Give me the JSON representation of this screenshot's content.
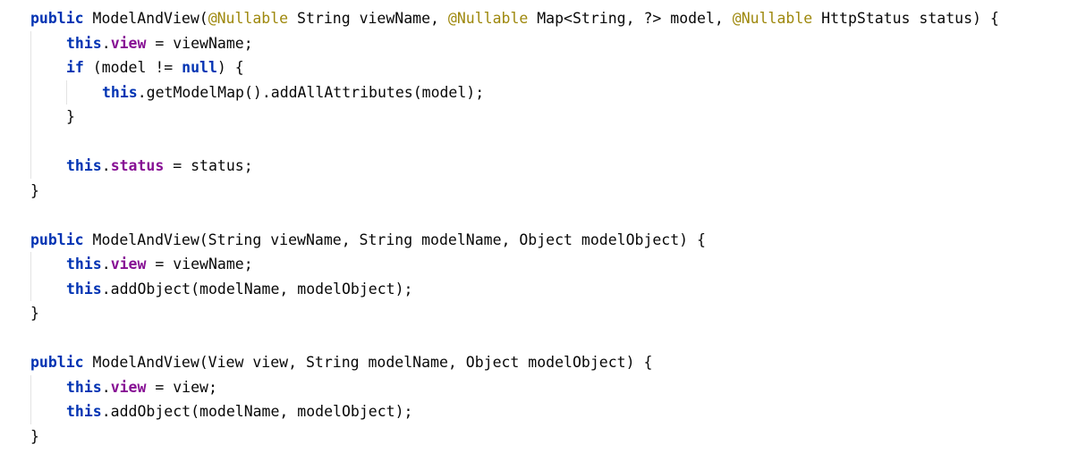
{
  "colors": {
    "background": "#ffffff",
    "keyword": "#0033b3",
    "annotation": "#9e880d",
    "field": "#871094",
    "text": "#080808",
    "indent_guide": "#e3e3e3"
  },
  "code": {
    "lines": [
      [
        {
          "t": "kw",
          "v": "public"
        },
        {
          "t": "plain",
          "v": " ModelAndView("
        },
        {
          "t": "ann",
          "v": "@Nullable"
        },
        {
          "t": "plain",
          "v": " String viewName, "
        },
        {
          "t": "ann",
          "v": "@Nullable"
        },
        {
          "t": "plain",
          "v": " Map<String, ?> model, "
        },
        {
          "t": "ann",
          "v": "@Nullable"
        },
        {
          "t": "plain",
          "v": " HttpStatus status) {"
        }
      ],
      [
        {
          "t": "kw",
          "v": "this"
        },
        {
          "t": "plain",
          "v": "."
        },
        {
          "t": "field",
          "v": "view"
        },
        {
          "t": "plain",
          "v": " = viewName;"
        }
      ],
      [
        {
          "t": "kw",
          "v": "if"
        },
        {
          "t": "plain",
          "v": " (model != "
        },
        {
          "t": "kw",
          "v": "null"
        },
        {
          "t": "plain",
          "v": ") {"
        }
      ],
      [
        {
          "t": "kw",
          "v": "this"
        },
        {
          "t": "plain",
          "v": ".getModelMap().addAllAttributes(model);"
        }
      ],
      [
        {
          "t": "plain",
          "v": "}"
        }
      ],
      [],
      [
        {
          "t": "kw",
          "v": "this"
        },
        {
          "t": "plain",
          "v": "."
        },
        {
          "t": "field",
          "v": "status"
        },
        {
          "t": "plain",
          "v": " = status;"
        }
      ],
      [
        {
          "t": "plain",
          "v": "}"
        }
      ],
      [],
      [
        {
          "t": "kw",
          "v": "public"
        },
        {
          "t": "plain",
          "v": " ModelAndView(String viewName, String modelName, Object modelObject) {"
        }
      ],
      [
        {
          "t": "kw",
          "v": "this"
        },
        {
          "t": "plain",
          "v": "."
        },
        {
          "t": "field",
          "v": "view"
        },
        {
          "t": "plain",
          "v": " = viewName;"
        }
      ],
      [
        {
          "t": "kw",
          "v": "this"
        },
        {
          "t": "plain",
          "v": ".addObject(modelName, modelObject);"
        }
      ],
      [
        {
          "t": "plain",
          "v": "}"
        }
      ],
      [],
      [
        {
          "t": "kw",
          "v": "public"
        },
        {
          "t": "plain",
          "v": " ModelAndView(View view, String modelName, Object modelObject) {"
        }
      ],
      [
        {
          "t": "kw",
          "v": "this"
        },
        {
          "t": "plain",
          "v": "."
        },
        {
          "t": "field",
          "v": "view"
        },
        {
          "t": "plain",
          "v": " = view;"
        }
      ],
      [
        {
          "t": "kw",
          "v": "this"
        },
        {
          "t": "plain",
          "v": ".addObject(modelName, modelObject);"
        }
      ],
      [
        {
          "t": "plain",
          "v": "}"
        }
      ]
    ]
  }
}
